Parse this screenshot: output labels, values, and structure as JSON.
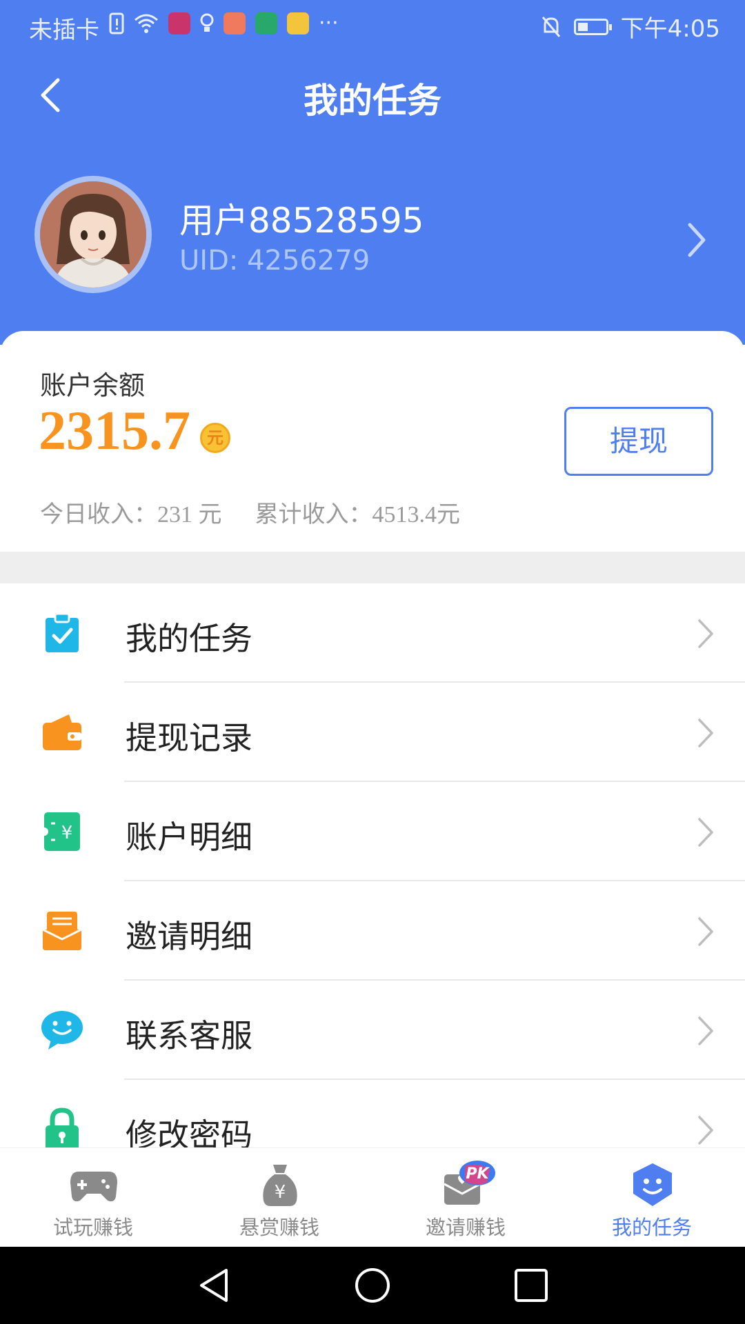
{
  "status_bar": {
    "carrier": "未插卡",
    "dots": "···",
    "time": "下午4:05"
  },
  "header": {
    "title": "我的任务"
  },
  "profile": {
    "username": "用户88528595",
    "uid": "UID: 4256279"
  },
  "balance": {
    "label": "账户余额",
    "value": "2315.7",
    "unit_badge": "元",
    "withdraw_label": "提现",
    "today_income": "今日收入：231 元",
    "total_income": "累计收入：4513.4元"
  },
  "menu": {
    "items": [
      {
        "label": "我的任务",
        "icon": "clipboard-check-icon",
        "color": "#1fb6e8"
      },
      {
        "label": "提现记录",
        "icon": "wallet-icon",
        "color": "#f7931e"
      },
      {
        "label": "账户明细",
        "icon": "yuan-bill-icon",
        "color": "#22c389"
      },
      {
        "label": "邀请明细",
        "icon": "envelope-icon",
        "color": "#f7931e"
      },
      {
        "label": "联系客服",
        "icon": "chat-smile-icon",
        "color": "#1fb6e8"
      },
      {
        "label": "修改密码",
        "icon": "lock-icon",
        "color": "#22c389"
      }
    ]
  },
  "bottom_nav": {
    "items": [
      {
        "label": "试玩赚钱",
        "icon": "gamepad-icon",
        "active": false
      },
      {
        "label": "悬赏赚钱",
        "icon": "money-bag-icon",
        "active": false
      },
      {
        "label": "邀请赚钱",
        "icon": "pk-envelope-icon",
        "active": false,
        "badge": "PK"
      },
      {
        "label": "我的任务",
        "icon": "smile-shield-icon",
        "active": true
      }
    ]
  },
  "colors": {
    "primary": "#4e7ef0",
    "accent": "#f7931e",
    "inactive": "#8a8a8a"
  }
}
